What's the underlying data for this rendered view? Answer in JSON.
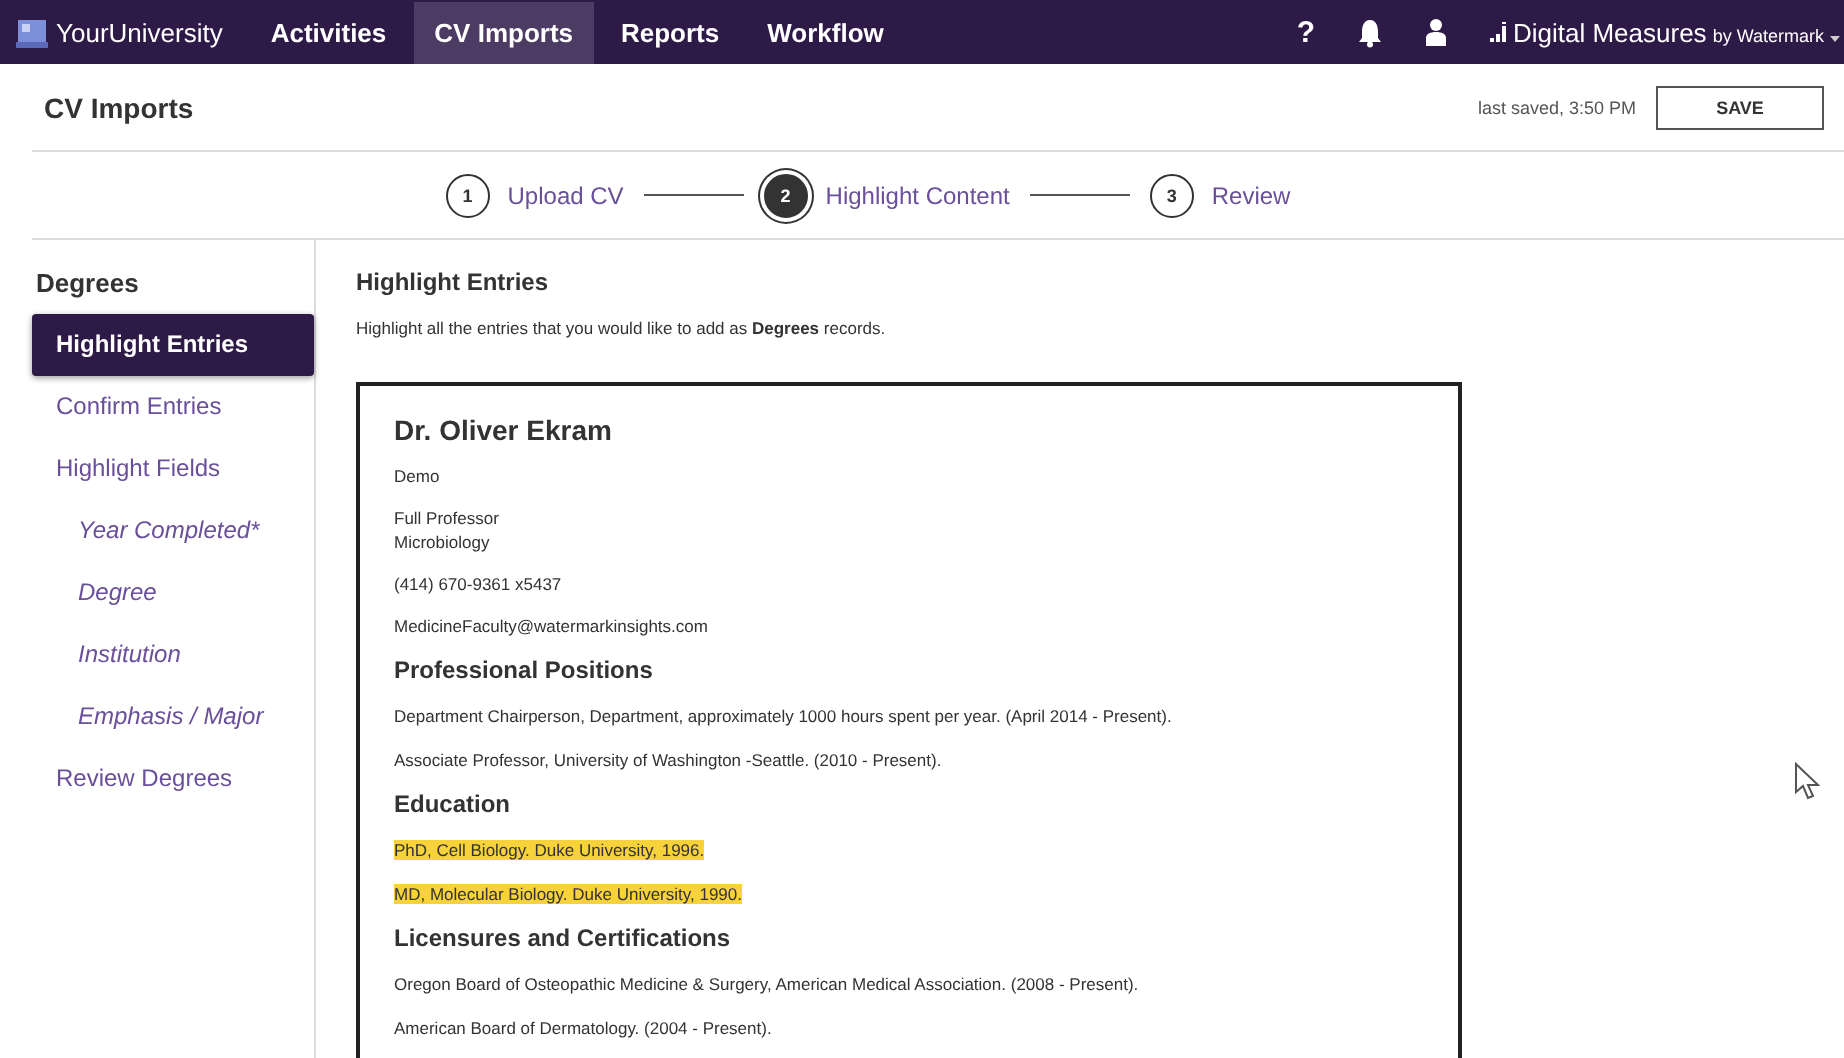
{
  "topbar": {
    "brand": "YourUniversity",
    "tabs": [
      {
        "label": "Activities",
        "selected": false
      },
      {
        "label": "CV Imports",
        "selected": true
      },
      {
        "label": "Reports",
        "selected": false
      },
      {
        "label": "Workflow",
        "selected": false
      }
    ],
    "help": "?",
    "product": "Digital Measures",
    "product_by": "by Watermark"
  },
  "header": {
    "title": "CV Imports",
    "last_saved": "last saved, 3:50 PM",
    "save_button": "SAVE"
  },
  "stepper": [
    {
      "number": "1",
      "label": "Upload CV",
      "selected": false
    },
    {
      "number": "2",
      "label": "Highlight Content",
      "selected": true
    },
    {
      "number": "3",
      "label": "Review",
      "selected": false
    }
  ],
  "sidebar": {
    "title": "Degrees",
    "items": [
      {
        "label": "Highlight Entries",
        "kind": "step",
        "selected": true
      },
      {
        "label": "Confirm Entries",
        "kind": "step",
        "selected": false
      },
      {
        "label": "Highlight Fields",
        "kind": "step",
        "selected": false
      },
      {
        "label": "Year Completed*",
        "kind": "field",
        "selected": false
      },
      {
        "label": "Degree",
        "kind": "field",
        "selected": false
      },
      {
        "label": "Institution",
        "kind": "field",
        "selected": false
      },
      {
        "label": "Emphasis / Major",
        "kind": "field",
        "selected": false
      },
      {
        "label": "Review Degrees",
        "kind": "step",
        "selected": false
      }
    ]
  },
  "main": {
    "title": "Highlight Entries",
    "instruction": "Highlight all the entries that you would like to add as **Degrees** records.",
    "cv": {
      "name": "Dr. Oliver Ekram",
      "details": [
        {
          "lines": [
            "Demo"
          ]
        },
        {
          "lines": [
            "Full Professor",
            "Microbiology"
          ]
        },
        {
          "lines": [
            "(414) 670-9361 x5437"
          ]
        },
        {
          "lines": [
            "MedicineFaculty@watermarkinsights.com"
          ]
        }
      ],
      "sections": [
        {
          "heading": "Professional Positions",
          "entries": [
            {
              "text": "Department Chairperson, Department, approximately 1000 hours spent per year. (April 2014 - Present).",
              "highlighted": false
            },
            {
              "text": "Associate Professor, University of Washington -Seattle. (2010 - Present).",
              "highlighted": false
            }
          ]
        },
        {
          "heading": "Education",
          "entries": [
            {
              "text": "PhD, Cell Biology. Duke University, 1996.",
              "highlighted": true
            },
            {
              "text": "MD, Molecular Biology. Duke University, 1990.",
              "highlighted": true
            }
          ]
        },
        {
          "heading": "Licensures and Certifications",
          "entries": [
            {
              "text": "Oregon Board of Osteopathic Medicine & Surgery, American Medical Association. (2008 - Present).",
              "highlighted": false
            },
            {
              "text": "American Board of Dermatology. (2004 - Present).",
              "highlighted": false
            }
          ]
        }
      ]
    }
  }
}
